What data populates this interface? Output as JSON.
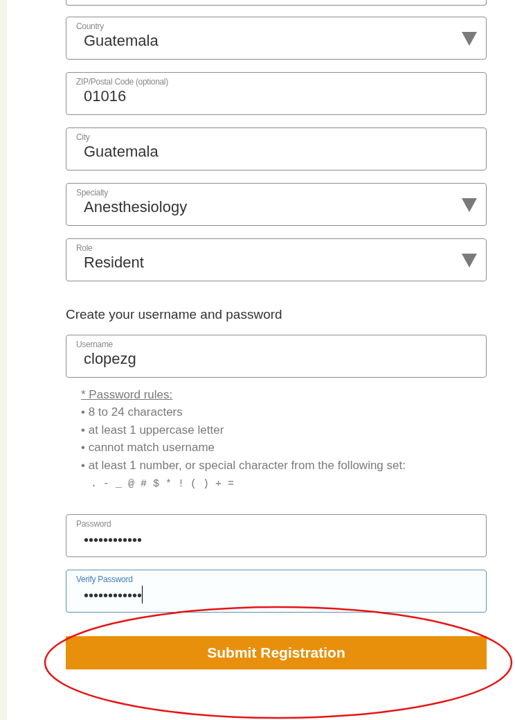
{
  "fields": [
    {
      "kind": "select",
      "label": "Country",
      "value": "Guatemala",
      "focused": false
    },
    {
      "kind": "text",
      "label": "ZIP/Postal Code (optional)",
      "value": "01016",
      "focused": false
    },
    {
      "kind": "text",
      "label": "City",
      "value": "Guatemala",
      "focused": false
    },
    {
      "kind": "select",
      "label": "Specialty",
      "value": "Anesthesiology",
      "focused": false
    },
    {
      "kind": "select",
      "label": "Role",
      "value": "Resident",
      "focused": false
    }
  ],
  "credentials_heading": "Create your username and password",
  "username": {
    "kind": "text",
    "label": "Username",
    "value": "clopezg",
    "focused": false
  },
  "password_rules": {
    "title": "* Password rules:",
    "items": [
      "• 8 to 24 characters",
      "• at least 1 uppercase letter",
      "• cannot match username",
      "• at least 1 number, or special character from the following set:"
    ],
    "special_characters": ". - _ @ # $ * ! ( ) + ="
  },
  "password_fields": [
    {
      "kind": "password",
      "label": "Password",
      "value": "••••••••••••",
      "focused": false
    },
    {
      "kind": "password",
      "label": "Verify Password",
      "value": "••••••••••••",
      "focused": true
    }
  ],
  "submit_button": {
    "label": "Submit Registration",
    "highlighted": true
  }
}
